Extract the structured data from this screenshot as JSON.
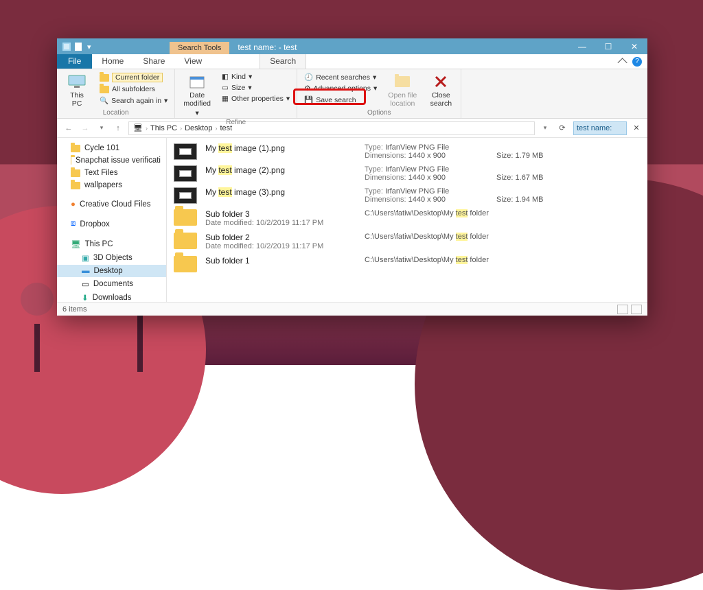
{
  "window": {
    "context_tab": "Search Tools",
    "title": "test name: - test"
  },
  "ribbon_tabs": {
    "file": "File",
    "tabs": [
      "Home",
      "Share",
      "View"
    ],
    "active": "Search"
  },
  "ribbon": {
    "location": {
      "thispc": "This\nPC",
      "current_folder": "Current folder",
      "all_subfolders": "All subfolders",
      "search_again": "Search again in",
      "label": "Location"
    },
    "refine": {
      "date": "Date\nmodified",
      "kind": "Kind",
      "size": "Size",
      "other": "Other properties",
      "label": "Refine"
    },
    "options": {
      "recent": "Recent searches",
      "advanced": "Advanced options",
      "save": "Save search",
      "open_file": "Open file\nlocation",
      "close": "Close\nsearch",
      "label": "Options"
    }
  },
  "breadcrumb": [
    "This PC",
    "Desktop",
    "test"
  ],
  "searchbox": {
    "value": "test name:"
  },
  "tree": {
    "quick": [
      {
        "label": "Cycle 101"
      },
      {
        "label": "Snapchat issue verificati"
      },
      {
        "label": "Text Files"
      },
      {
        "label": "wallpapers"
      }
    ],
    "ccf": "Creative Cloud Files",
    "dropbox": "Dropbox",
    "thispc": "This PC",
    "thispc_children": [
      {
        "label": "3D Objects"
      },
      {
        "label": "Desktop",
        "selected": true
      },
      {
        "label": "Documents"
      },
      {
        "label": "Downloads"
      }
    ]
  },
  "results": [
    {
      "kind": "img",
      "name_pre": "My ",
      "name_hl": "test",
      "name_post": " image (1).png",
      "type": "IrfanView PNG File",
      "dims": "1440 x 900",
      "size": "1.79 MB"
    },
    {
      "kind": "img",
      "name_pre": "My ",
      "name_hl": "test",
      "name_post": " image (2).png",
      "type": "IrfanView PNG File",
      "dims": "1440 x 900",
      "size": "1.67 MB"
    },
    {
      "kind": "img",
      "name_pre": "My ",
      "name_hl": "test",
      "name_post": " image (3).png",
      "type": "IrfanView PNG File",
      "dims": "1440 x 900",
      "size": "1.94 MB"
    },
    {
      "kind": "folder",
      "name": "Sub folder 3",
      "date": "10/2/2019 11:17 PM",
      "path_pre": "C:\\Users\\fatiw\\Desktop\\My ",
      "path_hl": "test",
      "path_post": " folder"
    },
    {
      "kind": "folder",
      "name": "Sub folder 2",
      "date": "10/2/2019 11:17 PM",
      "path_pre": "C:\\Users\\fatiw\\Desktop\\My ",
      "path_hl": "test",
      "path_post": " folder"
    },
    {
      "kind": "folder",
      "name": "Sub folder 1",
      "date": "",
      "path_pre": "C:\\Users\\fatiw\\Desktop\\My ",
      "path_hl": "test",
      "path_post": " folder"
    }
  ],
  "status": {
    "count": "6 items"
  },
  "labels": {
    "type": "Type:",
    "dims": "Dimensions:",
    "size": "Size:",
    "datemod": "Date modified:"
  }
}
